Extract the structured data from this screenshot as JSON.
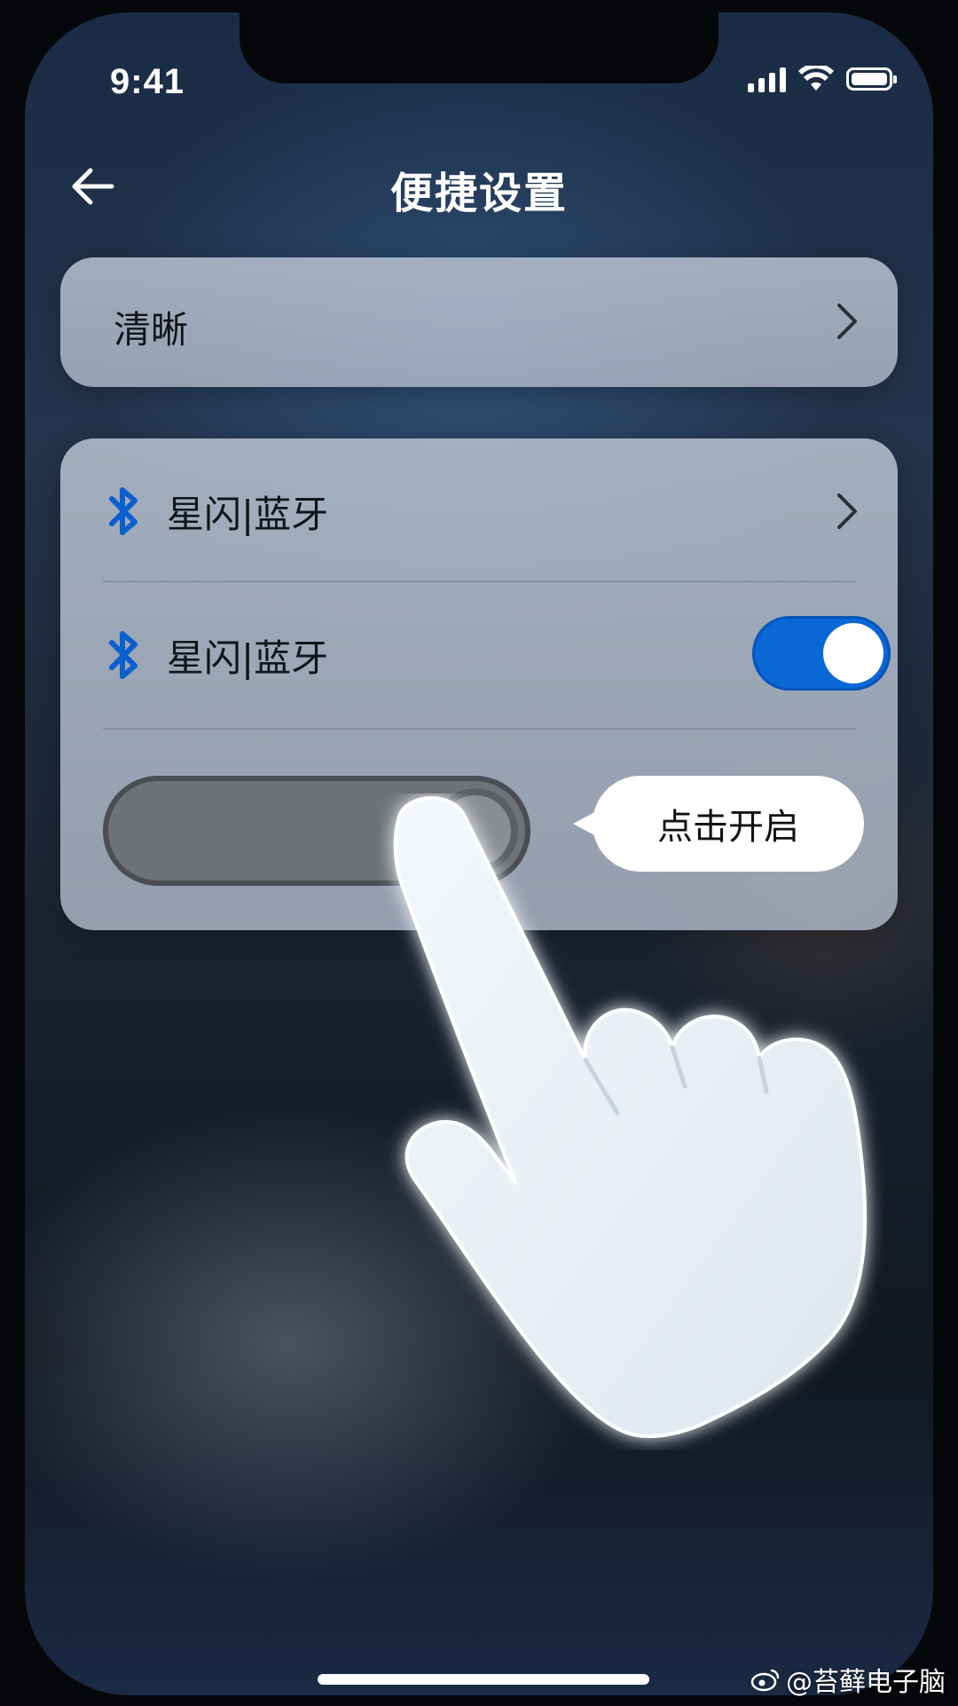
{
  "status_bar": {
    "time": "9:41"
  },
  "header": {
    "title": "便捷设置"
  },
  "settings": {
    "row_clarity": {
      "label": "清晰"
    },
    "row_bluetooth_nav": {
      "label": "星闪|蓝牙",
      "icon": "bluetooth-icon"
    },
    "row_bluetooth_toggle": {
      "label": "星闪|蓝牙",
      "icon": "bluetooth-icon",
      "enabled": true
    },
    "row_new_toggle": {
      "enabled": false
    }
  },
  "tooltip": {
    "text": "点击开启"
  },
  "overlay": {
    "icon": "pointing-hand-icon"
  },
  "watermark": {
    "text": "@苔藓电子脑",
    "icon": "weibo-icon"
  },
  "colors": {
    "accent": "#0a67d6",
    "bluetooth": "#0b5fce"
  }
}
